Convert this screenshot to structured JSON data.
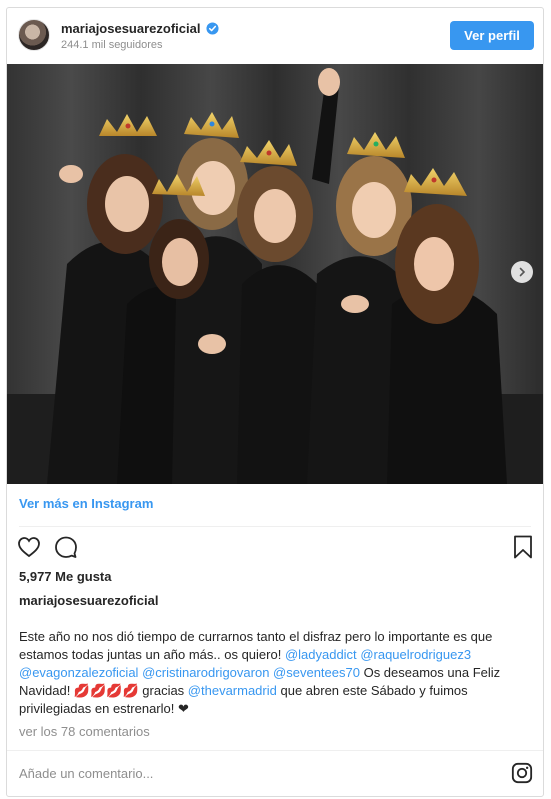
{
  "header": {
    "username": "mariajosesuarezoficial",
    "followers": "244.1 mil seguidores",
    "profile_button": "Ver perfil"
  },
  "post": {
    "see_more": "Ver más en Instagram",
    "likes": "5,977 Me gusta",
    "owner": "mariajosesuarezoficial",
    "caption": {
      "p1": "Este año no nos dió tiempo de currarnos tanto el disfraz pero lo importante es que estamos todas juntas un año más.. os quiero! ",
      "m1": "@ladyaddict",
      "m2": "@raquelrodriguez3",
      "m3": "@evagonzalezoficial",
      "m4": "@cristinarodrigovaron",
      "m5": "@seventees70",
      "p2": " Os deseamos una Feliz Navidad! 💋💋💋💋 gracias ",
      "m6": "@thevarmadrid",
      "p3": " que abren este Sábado y fuimos privilegiadas en estrenarlo! ❤"
    },
    "view_comments": "ver los 78 comentarios",
    "add_comment_placeholder": "Añade un comentario..."
  },
  "icons": {
    "verified": "verified-badge-icon",
    "like": "heart-icon",
    "comment": "comment-bubble-icon",
    "save": "bookmark-icon",
    "next": "chevron-right-icon",
    "instagram": "instagram-logo-icon"
  },
  "colors": {
    "accent": "#3897f0",
    "text": "#262626",
    "muted": "#8e8e8e"
  }
}
